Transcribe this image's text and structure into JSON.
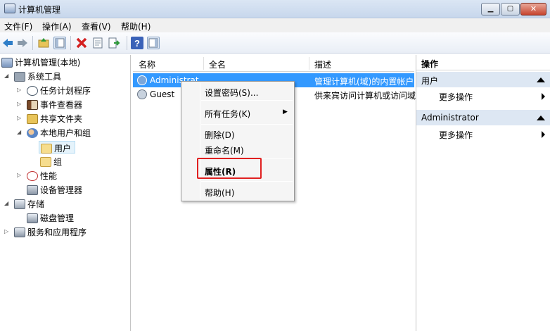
{
  "window": {
    "title": "计算机管理"
  },
  "window_buttons": {
    "min": "▁",
    "max": "▢",
    "close": "✕"
  },
  "menu": [
    "文件(F)",
    "操作(A)",
    "查看(V)",
    "帮助(H)"
  ],
  "tree": {
    "root": "计算机管理(本地)",
    "system_tools": "系统工具",
    "task_scheduler": "任务计划程序",
    "event_viewer": "事件查看器",
    "shared_folders": "共享文件夹",
    "local_users_groups": "本地用户和组",
    "users": "用户",
    "groups": "组",
    "performance": "性能",
    "device_manager": "设备管理器",
    "storage": "存储",
    "disk_management": "磁盘管理",
    "services_apps": "服务和应用程序"
  },
  "list": {
    "columns": [
      "名称",
      "全名",
      "描述"
    ],
    "rows": [
      {
        "name": "Administrat",
        "fullname": "",
        "desc": "管理计算机(域)的内置帐户"
      },
      {
        "name": "Guest",
        "fullname": "",
        "desc": "供来宾访问计算机或访问域"
      }
    ]
  },
  "actions": {
    "header": "操作",
    "section1": "用户",
    "section1_more": "更多操作",
    "section2": "Administrator",
    "section2_more": "更多操作"
  },
  "context_menu": {
    "set_password": "设置密码(S)...",
    "all_tasks": "所有任务(K)",
    "delete": "删除(D)",
    "rename": "重命名(M)",
    "properties": "属性(R)",
    "help": "帮助(H)"
  },
  "colors": {
    "selection": "#3399ff",
    "highlight_box": "#e02020",
    "section_bg": "#dde7f3"
  }
}
